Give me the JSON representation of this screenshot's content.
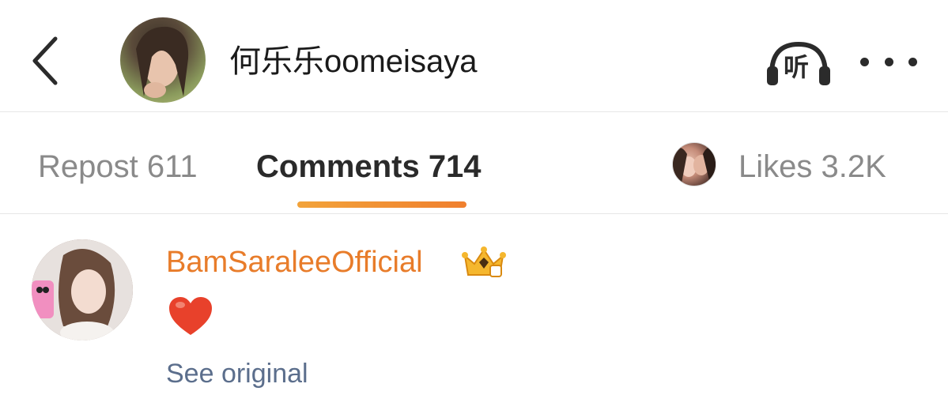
{
  "header": {
    "back_icon": "chevron-left-icon",
    "author_name": "何乐乐oomeisaya",
    "listen_label": "听",
    "listen_icon": "headphones-icon",
    "more_icon": "more-horizontal-icon"
  },
  "tabs": {
    "repost": "Repost 611",
    "comments": "Comments 714",
    "likes": "Likes 3.2K",
    "active": "comments",
    "accent_color": "#f07f2e"
  },
  "comment": {
    "username": "BamSaraleeOfficial",
    "badge_icon": "crown-badge-icon",
    "content_icon": "heart-emoji-icon",
    "see_original": "See original",
    "username_color": "#e87c2a",
    "link_color": "#5b6e8c"
  }
}
